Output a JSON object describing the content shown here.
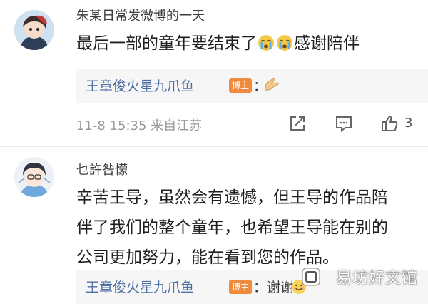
{
  "comments": [
    {
      "username": "朱某日常发微博的一天",
      "body_lines": [
        "最后一部的童年要结束了",
        "感谢陪伴"
      ],
      "reply": {
        "author": "王章俊火星九爪鱼",
        "badge": "博主",
        "text": "："
      },
      "meta": "11-8 15:35 来自江苏",
      "like_count": "3"
    },
    {
      "username": "乜許咎懞",
      "body_lines": [
        "辛苦王导，虽然会有遗憾，但王导的作品陪",
        "伴了我们的整个童年，也希望王导能在别的",
        "公司更加努力，能在看到您的作品。"
      ],
      "reply": {
        "author": "王章俊火星九爪鱼",
        "badge": "博主",
        "text": "：谢谢"
      }
    }
  ],
  "watermark": "易坊好文馆",
  "colors": {
    "link_blue": "#4e6fa3",
    "badge_orange": "#f08a3c",
    "meta_gray": "#9a9a9a",
    "reply_bg": "#f6f6f6"
  },
  "icons": [
    "share-icon",
    "comment-icon",
    "like-icon",
    "crying-emoji",
    "pray-emoji",
    "smile-emoji"
  ]
}
